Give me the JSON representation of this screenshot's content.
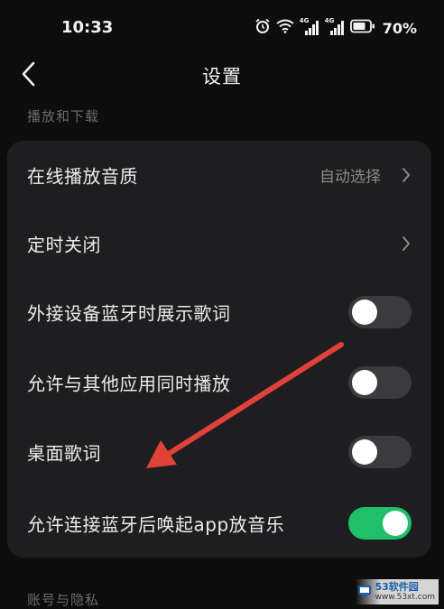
{
  "status_bar": {
    "time": "10:33",
    "battery_percent": "70%",
    "signal_label_1": "4G",
    "signal_label_2": "4G"
  },
  "nav": {
    "title": "设置"
  },
  "sections": {
    "playback_download": "播放和下载",
    "account_privacy": "账号与隐私"
  },
  "settings": [
    {
      "label": "在线播放音质",
      "value": "自动选择",
      "control": "chevron"
    },
    {
      "label": "定时关闭",
      "control": "chevron"
    },
    {
      "label": "外接设备蓝牙时展示歌词",
      "control": "toggle",
      "on": false
    },
    {
      "label": "允许与其他应用同时播放",
      "control": "toggle",
      "on": false
    },
    {
      "label": "桌面歌词",
      "control": "toggle",
      "on": false
    },
    {
      "label": "允许连接蓝牙后唤起app放音乐",
      "control": "toggle",
      "on": true
    }
  ],
  "colors": {
    "background": "#0d0d0d",
    "card": "#1e1e20",
    "toggle_on": "#1ec16a",
    "toggle_off": "#3b3b3e",
    "annotation_arrow": "#e0423a"
  },
  "watermark": {
    "line1": "53软件园",
    "line2": "www.53xt.com"
  }
}
